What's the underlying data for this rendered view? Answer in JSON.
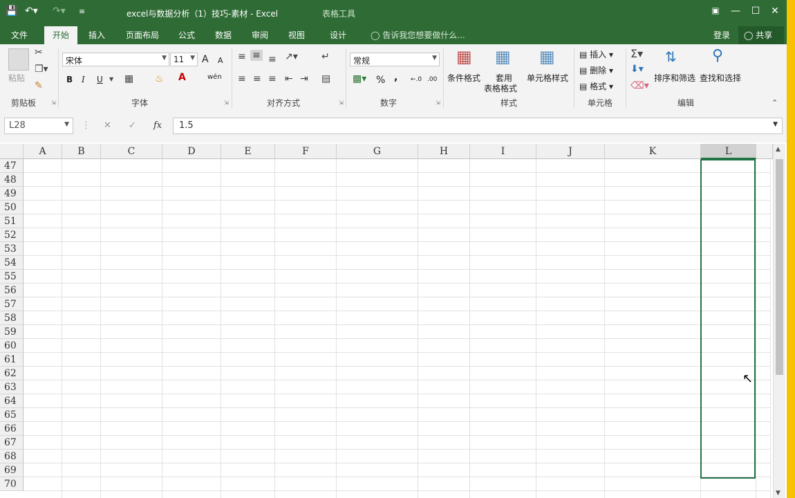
{
  "window": {
    "title": "excel与数据分析（1）技巧-素材 - Excel",
    "context_tab": "表格工具"
  },
  "tabs": [
    "文件",
    "开始",
    "插入",
    "页面布局",
    "公式",
    "数据",
    "审阅",
    "视图",
    "设计"
  ],
  "active_tab": "开始",
  "tell_me": "告诉我您想要做什么...",
  "account": {
    "login": "登录",
    "share": "共享"
  },
  "ribbon": {
    "clipboard": {
      "label": "剪贴板",
      "paste": "粘贴"
    },
    "font": {
      "label": "字体",
      "family": "宋体",
      "size": "11",
      "bold": "B",
      "italic": "I",
      "underline": "U",
      "grow": "A",
      "shrink": "A",
      "phonetic": "wén"
    },
    "alignment": {
      "label": "对齐方式"
    },
    "number": {
      "label": "数字",
      "format": "常规",
      "percent": "%",
      "comma": ",",
      "inc": "←.0",
      "dec": ".00"
    },
    "styles": {
      "label": "样式",
      "conditional": "条件格式",
      "table_format_1": "套用",
      "table_format_2": "表格格式",
      "cell_styles": "单元格样式"
    },
    "cells": {
      "label": "单元格",
      "insert": "插入",
      "delete": "删除",
      "format": "格式"
    },
    "editing": {
      "label": "编辑",
      "sort_filter": "排序和筛选",
      "find_select": "查找和选择"
    }
  },
  "formula_bar": {
    "name_box": "L28",
    "value": "1.5"
  },
  "columns": [
    "A",
    "B",
    "C",
    "D",
    "E",
    "F",
    "G",
    "H",
    "I",
    "J",
    "K",
    "L"
  ],
  "selected_column": "L",
  "rows": [
    "47",
    "48",
    "49",
    "50",
    "51",
    "52",
    "53",
    "54",
    "55",
    "56",
    "57",
    "58",
    "59",
    "60",
    "61",
    "62",
    "63",
    "64",
    "65",
    "66",
    "67",
    "68",
    "69",
    "70"
  ],
  "colors": {
    "titlebar": "#2f6b35",
    "accent": "#217346",
    "window_edge": "#f7c300"
  }
}
